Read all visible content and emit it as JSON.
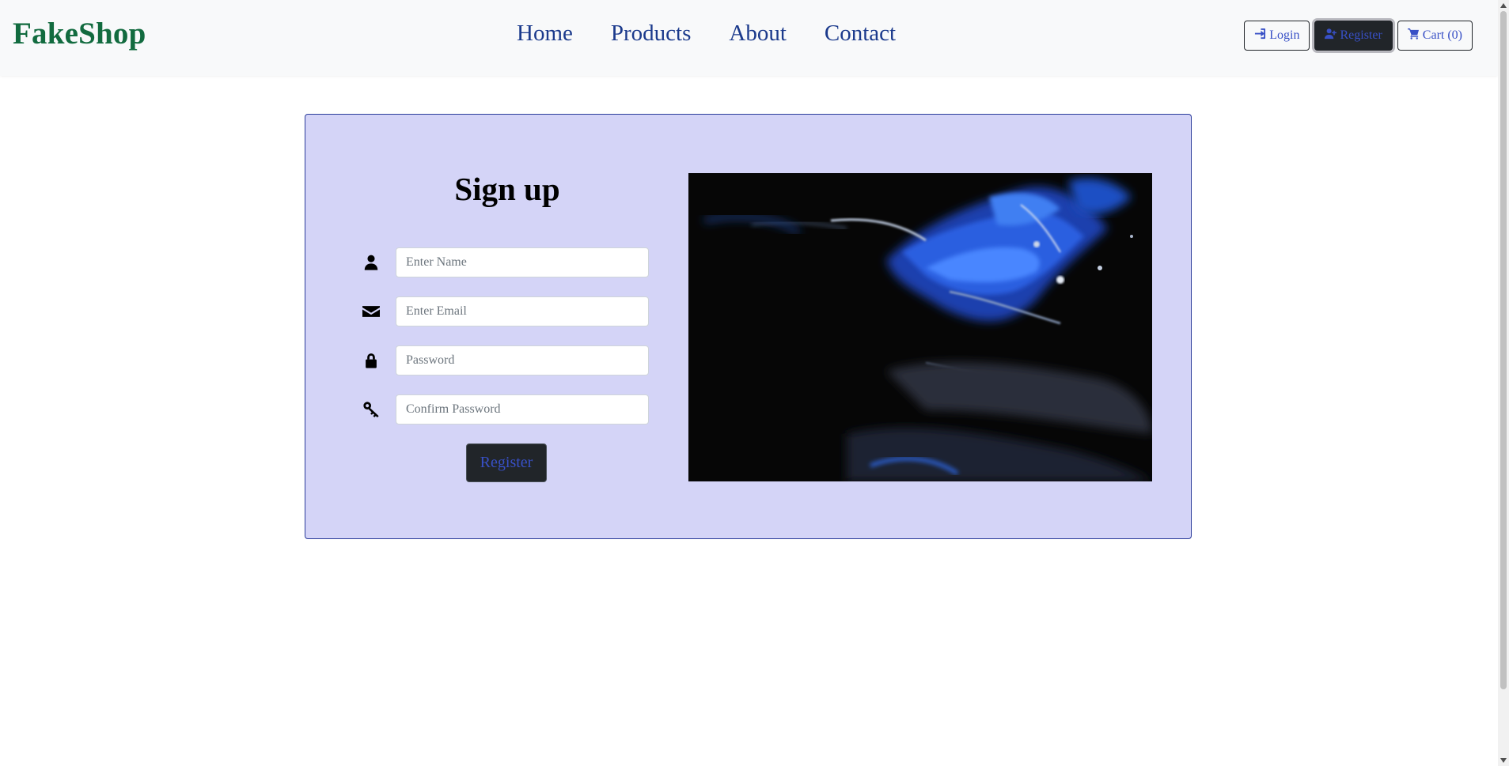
{
  "brand": "FakeShop",
  "nav": {
    "links": [
      "Home",
      "Products",
      "About",
      "Contact"
    ]
  },
  "actions": {
    "login": "Login",
    "register": "Register",
    "cart": "Cart (0)"
  },
  "signup": {
    "title": "Sign up",
    "name_placeholder": "Enter Name",
    "email_placeholder": "Enter Email",
    "password_placeholder": "Password",
    "confirm_placeholder": "Confirm Password",
    "submit": "Register"
  },
  "icons": {
    "login": "sign-in-icon",
    "register": "user-plus-icon",
    "cart": "shopping-cart-icon",
    "name": "user-icon",
    "email": "envelope-icon",
    "password": "lock-icon",
    "confirm": "key-icon"
  },
  "colors": {
    "brand": "#126b3f",
    "card_bg": "#d4d4f7",
    "link": "#1b3a8c",
    "accent": "#3850c6"
  }
}
